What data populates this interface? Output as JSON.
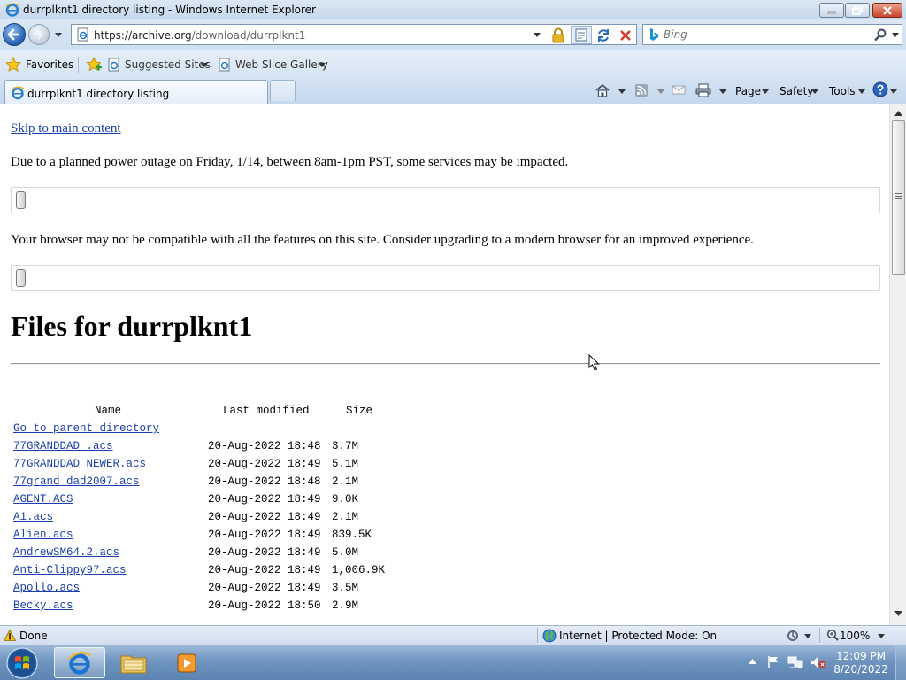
{
  "window": {
    "title": "durrplknt1 directory listing - Windows Internet Explorer"
  },
  "address_bar": {
    "url_host": "https://archive.org",
    "url_path": "/download/durrplknt1"
  },
  "search": {
    "placeholder": "Bing"
  },
  "favorites_bar": {
    "favorites_label": "Favorites",
    "items": [
      {
        "label": "Suggested Sites"
      },
      {
        "label": "Web Slice Gallery"
      }
    ]
  },
  "tabs": [
    {
      "label": "durrplknt1 directory listing"
    }
  ],
  "command_bar": {
    "page_label": "Page",
    "safety_label": "Safety",
    "tools_label": "Tools"
  },
  "page": {
    "skip_link": "Skip to main content",
    "notice_outage": "Due to a planned power outage on Friday, 1/14, between 8am-1pm PST, some services may be impacted.",
    "notice_browser": "Your browser may not be compatible with all the features on this site. Consider upgrading to a modern browser for an improved experience.",
    "heading": "Files for durrplknt1",
    "table": {
      "headers": {
        "name": "Name",
        "modified": "Last modified",
        "size": "Size"
      },
      "parent_link": "Go to parent directory",
      "rows": [
        {
          "name": "77GRANDDAD_.acs",
          "modified": "20-Aug-2022 18:48",
          "size": "3.7M"
        },
        {
          "name": "77GRANDDAD_NEWER.acs",
          "modified": "20-Aug-2022 18:49",
          "size": "5.1M"
        },
        {
          "name": "77grand_dad2007.acs",
          "modified": "20-Aug-2022 18:48",
          "size": "2.1M"
        },
        {
          "name": "AGENT.ACS",
          "modified": "20-Aug-2022 18:49",
          "size": "9.0K"
        },
        {
          "name": "A1.acs",
          "modified": "20-Aug-2022 18:49",
          "size": "2.1M"
        },
        {
          "name": "Alien.acs",
          "modified": "20-Aug-2022 18:49",
          "size": "839.5K"
        },
        {
          "name": "AndrewSM64.2.acs",
          "modified": "20-Aug-2022 18:49",
          "size": "5.0M"
        },
        {
          "name": "Anti-Clippy97.acs",
          "modified": "20-Aug-2022 18:49",
          "size": "1,006.9K"
        },
        {
          "name": "Apollo.acs",
          "modified": "20-Aug-2022 18:49",
          "size": "3.5M"
        },
        {
          "name": "Becky.acs",
          "modified": "20-Aug-2022 18:50",
          "size": "2.9M"
        }
      ]
    }
  },
  "status_bar": {
    "status_text": "Done",
    "zone_text": "Internet | Protected Mode: On",
    "zoom_text": "100%"
  },
  "taskbar": {
    "time": "12:09 PM",
    "date": "8/20/2022"
  },
  "colors": {
    "link": "#1a3fb0",
    "taskbar": "#6e94bf",
    "chrome": "#d2dff0"
  }
}
